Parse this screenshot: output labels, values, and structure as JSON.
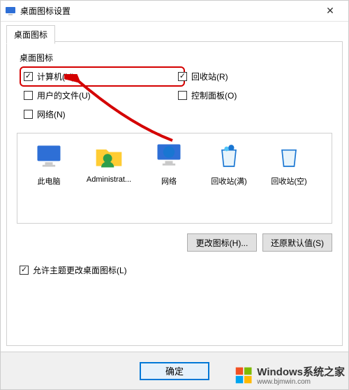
{
  "window": {
    "title": "桌面图标设置",
    "close_tooltip": "关闭"
  },
  "tab": {
    "label": "桌面图标"
  },
  "group": {
    "label": "桌面图标"
  },
  "checks": {
    "computer": "计算机(M)",
    "recycle": "回收站(R)",
    "userfiles": "用户的文件(U)",
    "control": "控制面板(O)",
    "network": "网络(N)"
  },
  "icons": {
    "thispc": "此电脑",
    "admin": "Administrat...",
    "network": "网络",
    "bin_full": "回收站(满)",
    "bin_empty": "回收站(空)"
  },
  "buttons": {
    "change_icon": "更改图标(H)...",
    "restore_default": "还原默认值(S)",
    "ok": "确定"
  },
  "themecheck": "允许主题更改桌面图标(L)",
  "watermark": {
    "brand": "Windows系统之家",
    "url": "www.bjmwin.com"
  }
}
